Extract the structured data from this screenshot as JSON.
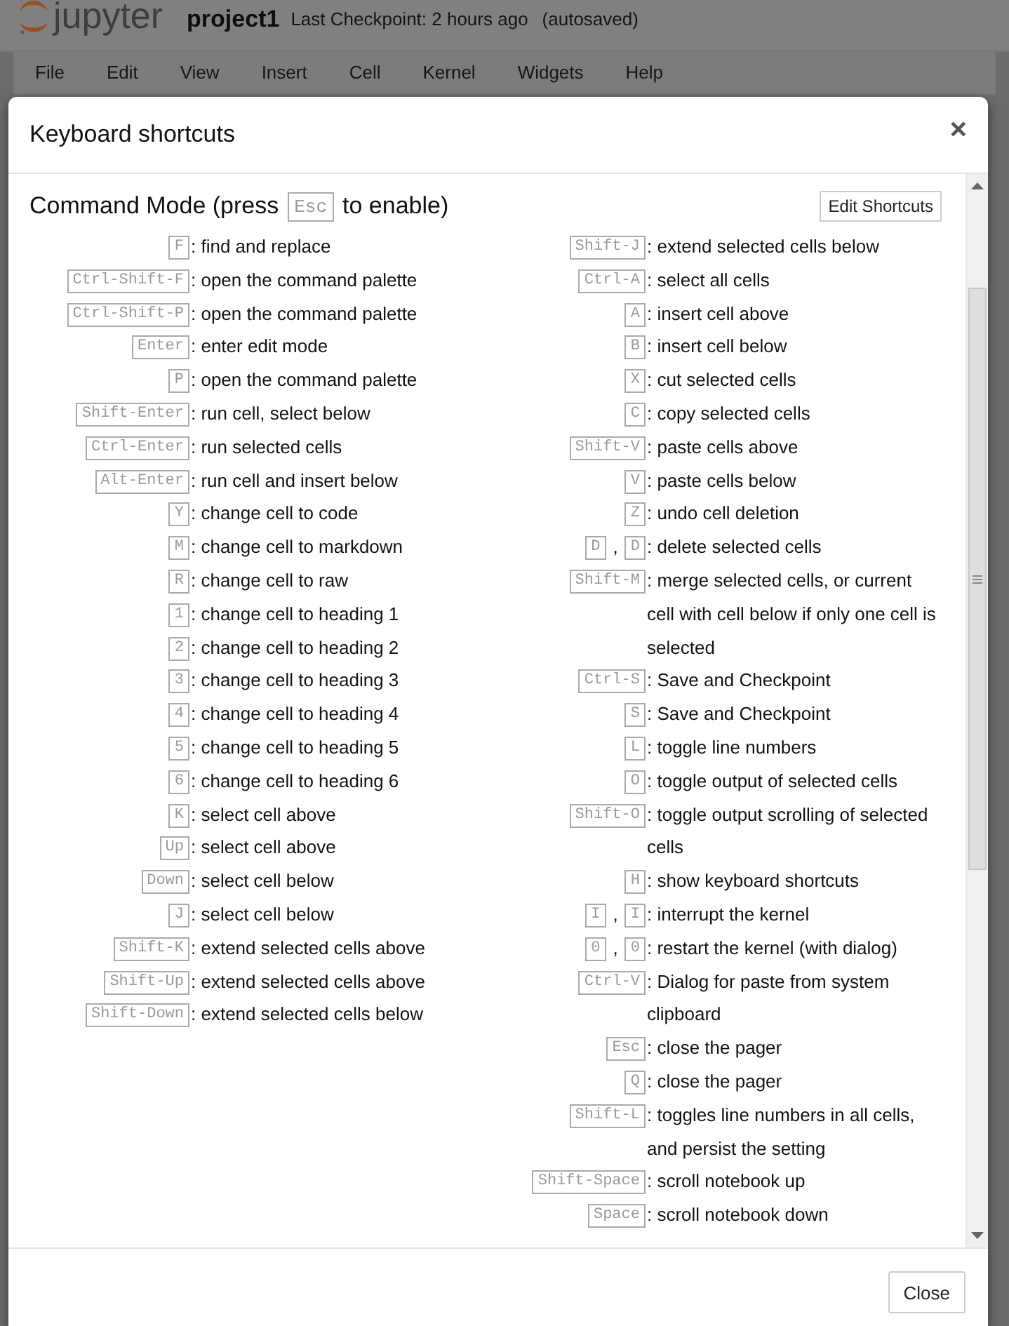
{
  "notebook": {
    "logo_text": "jupyter",
    "name": "project1",
    "checkpoint": "Last Checkpoint: 2 hours ago",
    "save_status": "(autosaved)"
  },
  "menu": [
    "File",
    "Edit",
    "View",
    "Insert",
    "Cell",
    "Kernel",
    "Widgets",
    "Help"
  ],
  "dialog": {
    "title": "Keyboard shortcuts",
    "close": "×",
    "section": {
      "title_start": "Command Mode (press",
      "title_key": "Esc",
      "title_end": "to enable)",
      "edit_button": "Edit Shortcuts"
    },
    "columns": [
      {
        "shortcuts": [
          {
            "keys": [
              "F"
            ],
            "description": ": find and replace"
          },
          {
            "keys": [
              "Ctrl-Shift-F"
            ],
            "description": ": open the command palette"
          },
          {
            "keys": [
              "Ctrl-Shift-P"
            ],
            "description": ": open the command palette"
          },
          {
            "keys": [
              "Enter"
            ],
            "description": ": enter edit mode"
          },
          {
            "keys": [
              "P"
            ],
            "description": ": open the command palette"
          },
          {
            "keys": [
              "Shift-Enter"
            ],
            "description": ": run cell, select below"
          },
          {
            "keys": [
              "Ctrl-Enter"
            ],
            "description": ": run selected cells"
          },
          {
            "keys": [
              "Alt-Enter"
            ],
            "description": ": run cell and insert below"
          },
          {
            "keys": [
              "Y"
            ],
            "description": ": change cell to code"
          },
          {
            "keys": [
              "M"
            ],
            "description": ": change cell to markdown"
          },
          {
            "keys": [
              "R"
            ],
            "description": ": change cell to raw"
          },
          {
            "keys": [
              "1"
            ],
            "description": ": change cell to heading 1"
          },
          {
            "keys": [
              "2"
            ],
            "description": ": change cell to heading 2"
          },
          {
            "keys": [
              "3"
            ],
            "description": ": change cell to heading 3"
          },
          {
            "keys": [
              "4"
            ],
            "description": ": change cell to heading 4"
          },
          {
            "keys": [
              "5"
            ],
            "description": ": change cell to heading 5"
          },
          {
            "keys": [
              "6"
            ],
            "description": ": change cell to heading 6"
          },
          {
            "keys": [
              "K"
            ],
            "description": ": select cell above"
          },
          {
            "keys": [
              "Up"
            ],
            "description": ": select cell above"
          },
          {
            "keys": [
              "Down"
            ],
            "description": ": select cell below"
          },
          {
            "keys": [
              "J"
            ],
            "description": ": select cell below"
          },
          {
            "keys": [
              "Shift-K"
            ],
            "description": ": extend selected cells above"
          },
          {
            "keys": [
              "Shift-Up"
            ],
            "description": ": extend selected cells above"
          },
          {
            "keys": [
              "Shift-Down"
            ],
            "description": ": extend selected cells below"
          }
        ]
      },
      {
        "shortcuts": [
          {
            "keys": [
              "Shift-J"
            ],
            "description": ": extend selected cells below"
          },
          {
            "keys": [
              "Ctrl-A"
            ],
            "description": ": select all cells"
          },
          {
            "keys": [
              "A"
            ],
            "description": ": insert cell above"
          },
          {
            "keys": [
              "B"
            ],
            "description": ": insert cell below"
          },
          {
            "keys": [
              "X"
            ],
            "description": ": cut selected cells"
          },
          {
            "keys": [
              "C"
            ],
            "description": ": copy selected cells"
          },
          {
            "keys": [
              "Shift-V"
            ],
            "description": ": paste cells above"
          },
          {
            "keys": [
              "V"
            ],
            "description": ": paste cells below"
          },
          {
            "keys": [
              "Z"
            ],
            "description": ": undo cell deletion"
          },
          {
            "keys": [
              "D",
              "D"
            ],
            "separator": ",",
            "description": ": delete selected cells"
          },
          {
            "keys": [
              "Shift-M"
            ],
            "description": ": merge selected cells, or current cell with cell below if only one cell is selected"
          },
          {
            "keys": [
              "Ctrl-S"
            ],
            "description": ": Save and Checkpoint"
          },
          {
            "keys": [
              "S"
            ],
            "description": ": Save and Checkpoint"
          },
          {
            "keys": [
              "L"
            ],
            "description": ": toggle line numbers"
          },
          {
            "keys": [
              "O"
            ],
            "description": ": toggle output of selected cells"
          },
          {
            "keys": [
              "Shift-O"
            ],
            "description": ": toggle output scrolling of selected cells"
          },
          {
            "keys": [
              "H"
            ],
            "description": ": show keyboard shortcuts"
          },
          {
            "keys": [
              "I",
              "I"
            ],
            "separator": ",",
            "description": ": interrupt the kernel"
          },
          {
            "keys": [
              "0",
              "0"
            ],
            "separator": ",",
            "description": ": restart the kernel (with dialog)"
          },
          {
            "keys": [
              "Ctrl-V"
            ],
            "description": ": Dialog for paste from system clipboard"
          },
          {
            "keys": [
              "Esc"
            ],
            "description": ": close the pager"
          },
          {
            "keys": [
              "Q"
            ],
            "description": ": close the pager"
          },
          {
            "keys": [
              "Shift-L"
            ],
            "description": ": toggles line numbers in all cells, and persist the setting"
          },
          {
            "keys": [
              "Shift-Space"
            ],
            "description": ": scroll notebook up"
          },
          {
            "keys": [
              "Space"
            ],
            "description": ": scroll notebook down"
          }
        ]
      }
    ],
    "close_button": "Close"
  }
}
